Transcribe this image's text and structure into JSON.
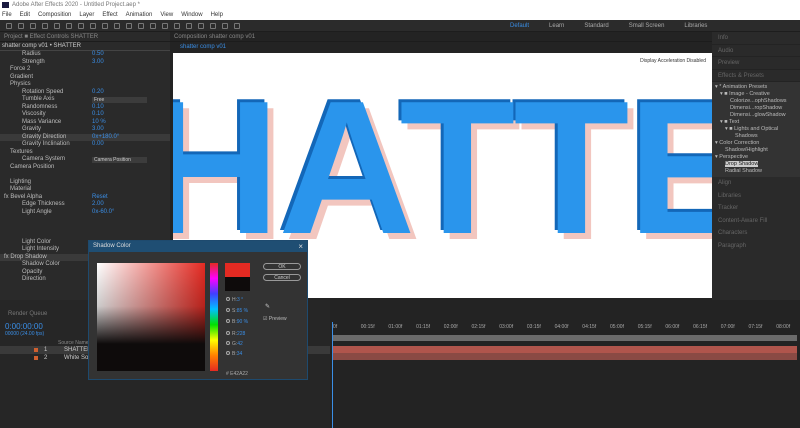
{
  "app": {
    "title": "Adobe After Effects 2020 - Untitled Project.aep *"
  },
  "menu": [
    "File",
    "Edit",
    "Composition",
    "Layer",
    "Effect",
    "Animation",
    "View",
    "Window",
    "Help"
  ],
  "workspaces": [
    "Default",
    "Learn",
    "Standard",
    "Small Screen",
    "Libraries"
  ],
  "left_panel": {
    "tabs": "Project  ■  Effect Controls SHATTER",
    "header": "shatter comp v01 • SHATTER",
    "rows": [
      {
        "l": "Radius",
        "v": "0.50",
        "i": 3
      },
      {
        "l": "Strength",
        "v": "3.00",
        "i": 3
      },
      {
        "l": "Force 2",
        "i": 1
      },
      {
        "l": "Gradient",
        "i": 1
      },
      {
        "l": "Physics",
        "i": 1
      },
      {
        "l": "Rotation Speed",
        "v": "0.20",
        "i": 3
      },
      {
        "l": "Tumble Axis",
        "dd": "Free",
        "i": 3
      },
      {
        "l": "Randomness",
        "v": "0.10",
        "i": 3
      },
      {
        "l": "Viscosity",
        "v": "0.10",
        "i": 3
      },
      {
        "l": "Mass Variance",
        "v": "10 %",
        "i": 3
      },
      {
        "l": "Gravity",
        "v": "3.00",
        "i": 3
      },
      {
        "l": "Gravity Direction",
        "v": "0x+180.0°",
        "i": 3,
        "sel": true
      },
      {
        "l": "Gravity Inclination",
        "v": "0.00",
        "i": 3
      },
      {
        "l": "Textures",
        "i": 1
      },
      {
        "l": "Camera System",
        "dd": "Camera Position",
        "i": 3
      },
      {
        "l": "Camera Position",
        "i": 1
      },
      {
        "l": "",
        "i": 1
      },
      {
        "l": "Lighting",
        "i": 1
      },
      {
        "l": "Material",
        "i": 1
      },
      {
        "l": "fx  Bevel Alpha",
        "v": "Reset",
        "i": 0
      },
      {
        "l": "Edge Thickness",
        "v": "2.00",
        "i": 3
      },
      {
        "l": "Light Angle",
        "v": "0x-60.0°",
        "i": 3
      },
      {
        "l": "",
        "i": 3
      },
      {
        "l": "",
        "i": 3
      },
      {
        "l": "",
        "i": 3
      },
      {
        "l": "Light Color",
        "i": 3
      },
      {
        "l": "Light Intensity",
        "v": "0.50",
        "i": 3
      },
      {
        "l": "fx  Drop Shadow",
        "i": 0,
        "sel": true
      },
      {
        "l": "Shadow Color",
        "i": 3
      },
      {
        "l": "Opacity",
        "i": 3
      },
      {
        "l": "Direction",
        "i": 3
      },
      {
        "l": "",
        "i": 3
      },
      {
        "l": "",
        "i": 3
      },
      {
        "l": "",
        "i": 3
      },
      {
        "l": "Distance",
        "i": 3
      },
      {
        "l": "Softness",
        "i": 3
      },
      {
        "l": "Shadow Only",
        "i": 3
      }
    ]
  },
  "viewer": {
    "tabs": "Composition shatter comp v01",
    "comp_tab": "shatter comp v01",
    "text": "HATTE",
    "notice": "Display Acceleration Disabled"
  },
  "right_panel": {
    "top": [
      "Info",
      "Audio",
      "Preview",
      "Effects & Presets"
    ],
    "presets": [
      {
        "l": "▾ * Animation Presets",
        "i": 0
      },
      {
        "l": "▾ ■ Image - Creative",
        "i": 1
      },
      {
        "l": "Colorize...ophShadows",
        "i": 3
      },
      {
        "l": "Dimensi...ropShadow",
        "i": 3
      },
      {
        "l": "Dimensi...glowShadow",
        "i": 3
      },
      {
        "l": "▾ ■ Text",
        "i": 1
      },
      {
        "l": "▾ ■ Lights and Optical",
        "i": 2
      },
      {
        "l": "Shadows",
        "i": 4
      },
      {
        "l": "▾ Color Correction",
        "i": 0
      },
      {
        "l": "Shadow/Highlight",
        "i": 2
      },
      {
        "l": "▾ Perspective",
        "i": 0
      },
      {
        "l": "Drop Shadow",
        "i": 2,
        "sel": true
      },
      {
        "l": "Radial Shadow",
        "i": 2
      }
    ],
    "bottom": [
      "Align",
      "Libraries",
      "Tracker",
      "Content-Aware Fill",
      "Characters",
      "Paragraph"
    ]
  },
  "timeline": {
    "render_queue": "Render Queue",
    "timecode": "0:00:00:00",
    "frames": "00000 (24.00 fps)",
    "col_header": "Source Name",
    "layers": [
      {
        "num": "1",
        "name": "SHATTER"
      },
      {
        "num": "2",
        "name": "White Solid"
      }
    ],
    "ticks": [
      "0f",
      "00:15f",
      "01:00f",
      "01:15f",
      "02:00f",
      "02:15f",
      "03:00f",
      "03:15f",
      "04:00f",
      "04:15f",
      "05:00f",
      "05:15f",
      "06:00f",
      "06:15f",
      "07:00f",
      "07:15f",
      "08:00f"
    ]
  },
  "dialog": {
    "title": "Shadow Color",
    "ok": "OK",
    "cancel": "Cancel",
    "preview": "Preview",
    "fields": [
      {
        "k": "H:",
        "v": "3 °"
      },
      {
        "k": "S:",
        "v": "85 %"
      },
      {
        "k": "B:",
        "v": "90 %"
      },
      {
        "k": "R:",
        "v": "228"
      },
      {
        "k": "G:",
        "v": "42"
      },
      {
        "k": "B:",
        "v": "34"
      }
    ],
    "hex": "# E42A22"
  },
  "colors": {
    "accent": "#3a8ee6",
    "text_blue": "#2a95ec",
    "shadow_red": "#e42a22",
    "layer_bar": "#b0554c"
  }
}
